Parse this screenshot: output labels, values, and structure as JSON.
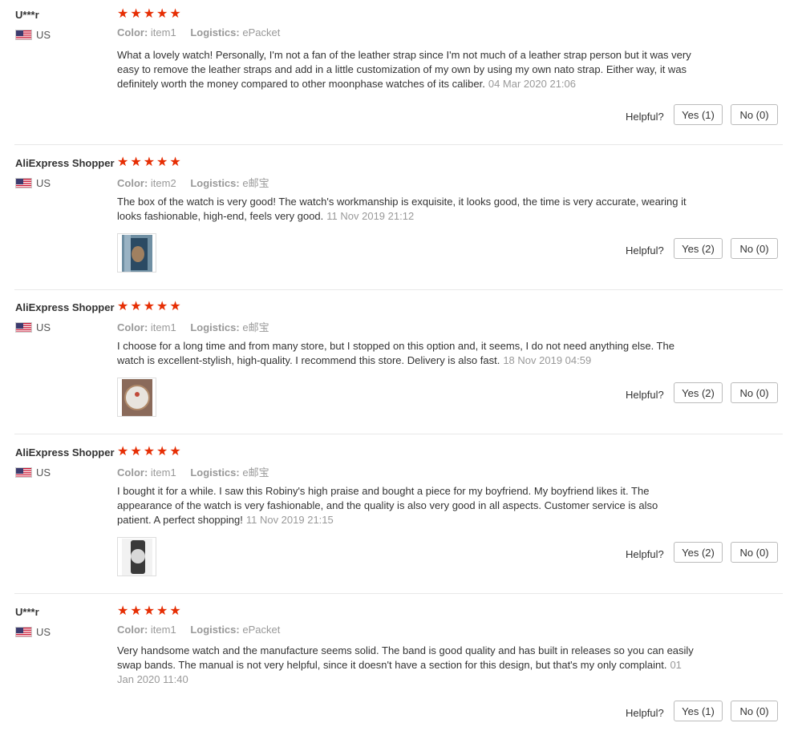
{
  "labels": {
    "color": "Color:",
    "logistics": "Logistics:",
    "helpful": "Helpful?"
  },
  "reviews": [
    {
      "user": "U***r",
      "country": "US",
      "rating": 5,
      "color": "item1",
      "logistics": "ePacket",
      "text": "What a lovely watch! Personally, I'm not a fan of the leather strap since I'm not much of a leather strap person but it was very easy to remove the leather straps and add in a little customization of my own by using my own nato strap. Either way, it was definitely worth the money compared to other moonphase watches of its caliber.",
      "date": "04 Mar 2020 21:06",
      "has_photo": false,
      "yes": "Yes (1)",
      "no": "No (0)"
    },
    {
      "user": "AliExpress Shopper",
      "country": "US",
      "rating": 5,
      "color": "item2",
      "logistics": "e邮宝",
      "text": "The box of the watch is very good! The watch's workmanship is exquisite, it looks good, the time is very accurate, wearing it looks fashionable, high-end, feels very good.",
      "date": "11 Nov 2019 21:12",
      "has_photo": true,
      "yes": "Yes (2)",
      "no": "No (0)"
    },
    {
      "user": "AliExpress Shopper",
      "country": "US",
      "rating": 5,
      "color": "item1",
      "logistics": "e邮宝",
      "text": "I choose for a long time and from many store, but I stopped on this option and, it seems, I do not need anything else. The watch is excellent-stylish, high-quality. I recommend this store. Delivery is also fast.",
      "date": "18 Nov 2019 04:59",
      "has_photo": true,
      "yes": "Yes (2)",
      "no": "No (0)"
    },
    {
      "user": "AliExpress Shopper",
      "country": "US",
      "rating": 5,
      "color": "item1",
      "logistics": "e邮宝",
      "text": "I bought it for a while. I saw this Robiny's high praise and bought a piece for my boyfriend. My boyfriend likes it. The appearance of the watch is very fashionable, and the quality is also very good in all aspects. Customer service is also patient. A perfect shopping!",
      "date": "11 Nov 2019 21:15",
      "has_photo": true,
      "yes": "Yes (2)",
      "no": "No (0)"
    },
    {
      "user": "U***r",
      "country": "US",
      "rating": 5,
      "color": "item1",
      "logistics": "ePacket",
      "text": "Very handsome watch and the manufacture seems solid. The band is good quality and has built in releases so you can easily swap bands. The manual is not very helpful, since it doesn't have a section for this design, but that's my only complaint.",
      "date": "01 Jan 2020 11:40",
      "has_photo": false,
      "yes": "Yes (1)",
      "no": "No (0)"
    }
  ]
}
